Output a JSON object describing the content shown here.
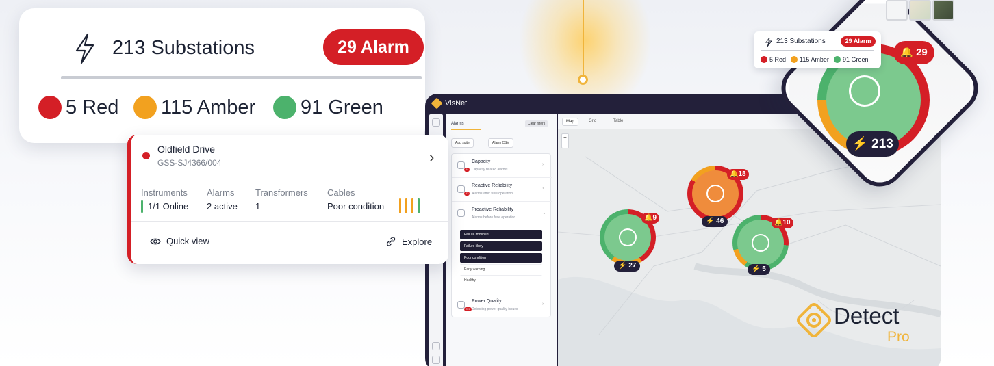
{
  "summary": {
    "substations": "213 Substations",
    "alarm": "29 Alarm",
    "legend": [
      {
        "label": "5 Red",
        "color": "#d41f26"
      },
      {
        "label": "115 Amber",
        "color": "#f2a11f"
      },
      {
        "label": "91 Green",
        "color": "#4cb26c"
      }
    ]
  },
  "site": {
    "name": "Oldfield Drive",
    "code": "GSS-SJ4366/004",
    "metrics": [
      {
        "label": "Instruments",
        "value": "1/1 Online"
      },
      {
        "label": "Alarms",
        "value": "2 active"
      },
      {
        "label": "Transformers",
        "value": "1"
      },
      {
        "label": "Cables",
        "value": "Poor condition"
      }
    ],
    "quick_view": "Quick view",
    "explore": "Explore"
  },
  "app": {
    "logo": "VisNet",
    "panel": {
      "tab": "Alarms",
      "clear_filters": "Clear filters",
      "buttons": [
        "App suite",
        "Alarm CSV"
      ],
      "sections": [
        {
          "title": "Capacity",
          "subtitle": "Capacity related alarms",
          "badge": "14"
        },
        {
          "title": "Reactive Reliability",
          "subtitle": "Alarms after fuse operation",
          "badge": "13"
        },
        {
          "title": "Proactive Reliability",
          "subtitle": "Alarms before fuse operation",
          "badge": ""
        },
        {
          "title": "Power Quality",
          "subtitle": "Detecting power quality issues",
          "badge": "257"
        }
      ],
      "subitems": [
        "Failure imminent",
        "Failure likely",
        "Poor condition",
        "Early warning",
        "Healthy"
      ]
    },
    "map_tabs": [
      "Map",
      "Grid",
      "Table"
    ],
    "zoom": [
      "+",
      "−"
    ]
  },
  "markers": [
    {
      "count": "27",
      "alarms": "9"
    },
    {
      "count": "46",
      "alarms": "18"
    },
    {
      "count": "5",
      "alarms": "10"
    }
  ],
  "diamond": {
    "count": "213",
    "alarms": "29",
    "card": {
      "title": "213 Substations",
      "alarm": "29 Alarm",
      "legend": [
        "5 Red",
        "115 Amber",
        "91 Green"
      ]
    }
  },
  "brand": {
    "word": "Detect",
    "pro": "Pro"
  }
}
